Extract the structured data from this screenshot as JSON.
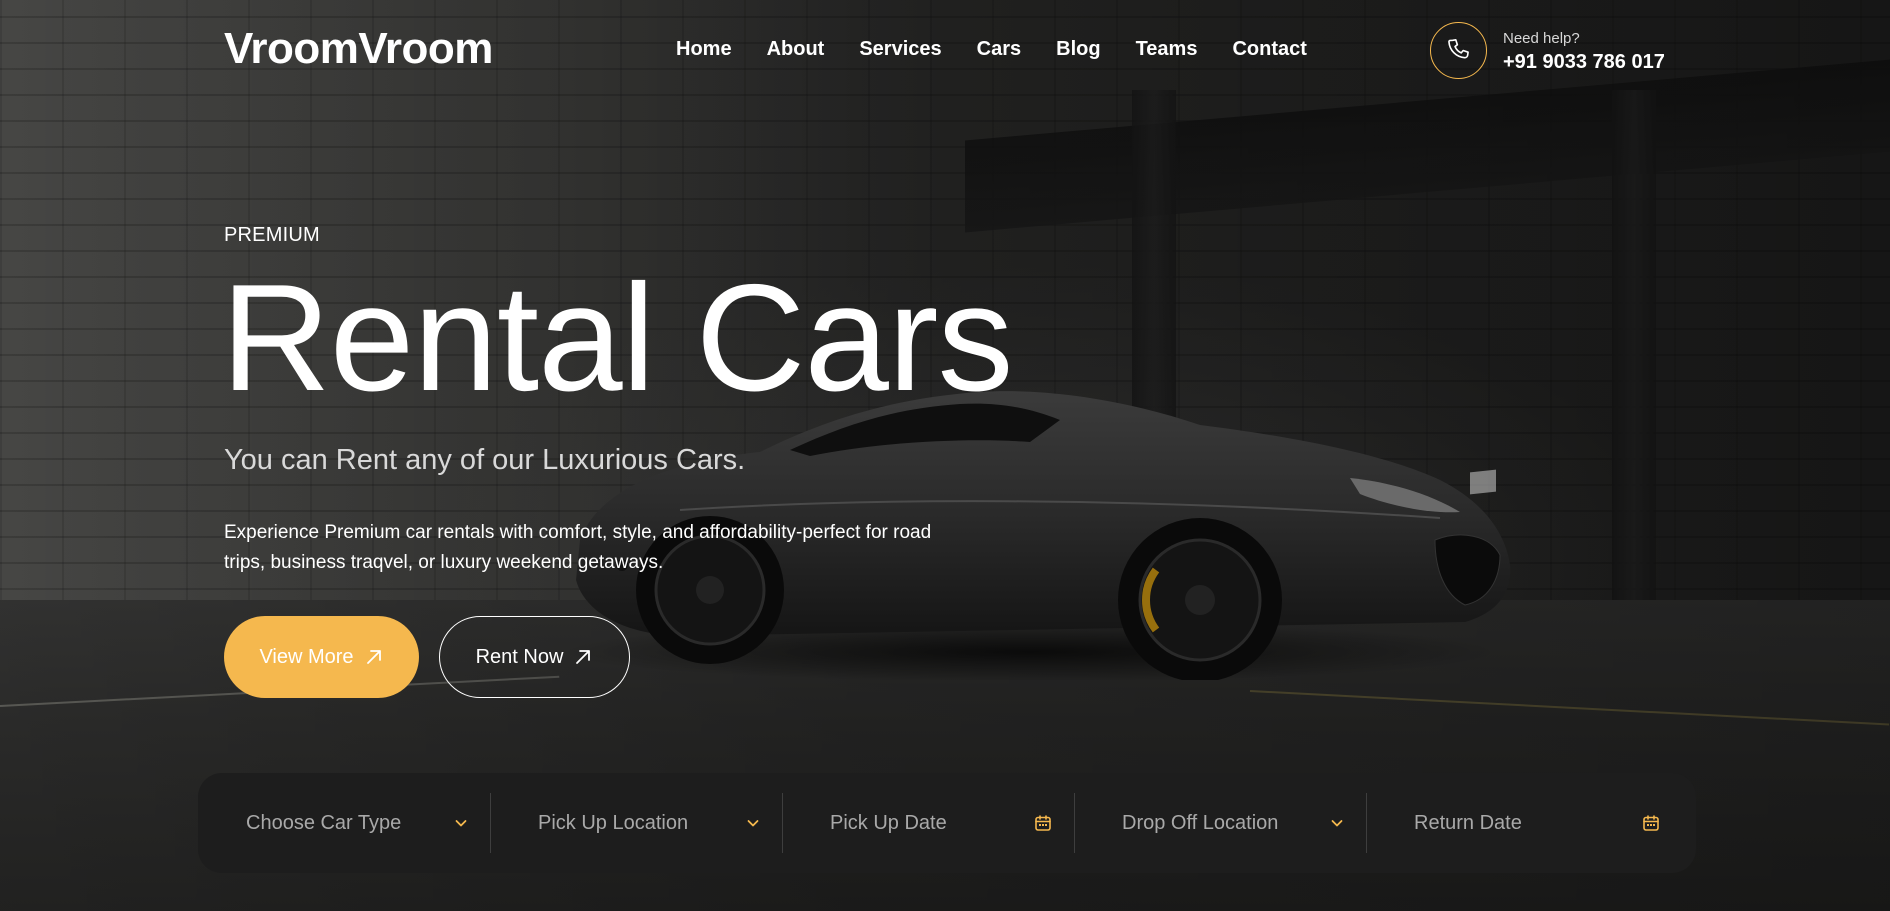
{
  "brand": {
    "name": "VroomVroom",
    "accent": "#f5b84e"
  },
  "nav": {
    "items": [
      {
        "label": "Home"
      },
      {
        "label": "About"
      },
      {
        "label": "Services"
      },
      {
        "label": "Cars"
      },
      {
        "label": "Blog"
      },
      {
        "label": "Teams"
      },
      {
        "label": "Contact"
      }
    ]
  },
  "help": {
    "label": "Need help?",
    "phone": "+91 9033 786 017",
    "icon": "phone-icon"
  },
  "hero": {
    "eyebrow": "PREMIUM",
    "title": "Rental Cars",
    "subtitle": "You can Rent any of our Luxurious Cars.",
    "description": "Experience Premium car rentals with comfort, style, and affordability-perfect for road trips, business traqvel, or luxury weekend getaways.",
    "primary_button": {
      "label": "View More",
      "icon": "arrow-up-right-icon"
    },
    "secondary_button": {
      "label": "Rent Now",
      "icon": "arrow-up-right-icon"
    }
  },
  "booking": {
    "fields": [
      {
        "label": "Choose Car Type",
        "icon": "chevron-down-icon"
      },
      {
        "label": "Pick Up Location",
        "icon": "chevron-down-icon"
      },
      {
        "label": "Pick Up Date",
        "icon": "calendar-icon"
      },
      {
        "label": "Drop Off Location",
        "icon": "chevron-down-icon"
      },
      {
        "label": "Return Date",
        "icon": "calendar-icon"
      }
    ]
  }
}
